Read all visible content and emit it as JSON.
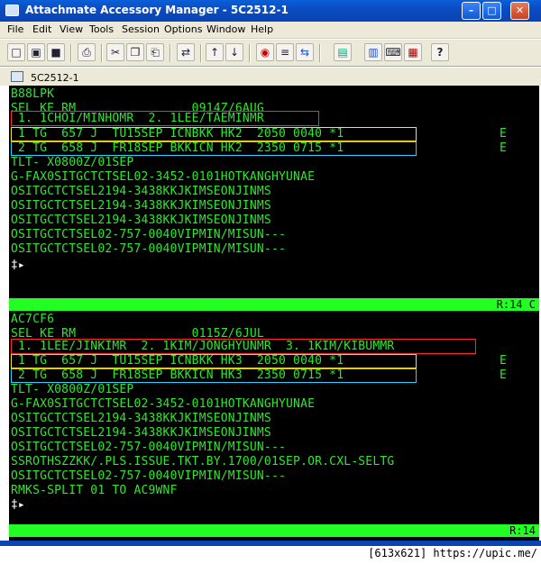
{
  "window": {
    "title": "Attachmate Accessory Manager - 5C2512-1",
    "min_glyph": "–",
    "max_glyph": "□",
    "close_glyph": "✕"
  },
  "menu": [
    "File",
    "Edit",
    "View",
    "Tools",
    "Session",
    "Options",
    "Window",
    "Help"
  ],
  "toolbar": {
    "buttons": [
      {
        "icon": "new-document-icon",
        "glyph": "□"
      },
      {
        "icon": "open-folder-icon",
        "glyph": "▣"
      },
      {
        "icon": "save-icon",
        "glyph": "■"
      },
      {
        "icon": "print-icon",
        "glyph": "⎙"
      },
      {
        "icon": "cut-icon",
        "glyph": "✂"
      },
      {
        "icon": "copy-icon",
        "glyph": "❐"
      },
      {
        "icon": "paste-icon",
        "glyph": "⎗"
      },
      {
        "icon": "connect-icon",
        "glyph": "⇄"
      },
      {
        "icon": "arrow-up-icon",
        "glyph": "↑"
      },
      {
        "icon": "arrow-down-icon",
        "glyph": "↓"
      },
      {
        "icon": "stop-icon",
        "glyph": "◉"
      },
      {
        "icon": "printer-session-icon",
        "glyph": "≡"
      },
      {
        "icon": "transfer-icon",
        "glyph": "⇆"
      },
      {
        "icon": "calculator-icon",
        "glyph": "▤"
      },
      {
        "icon": "notes-icon",
        "glyph": "▥"
      },
      {
        "icon": "keyboard-icon",
        "glyph": "⌨"
      },
      {
        "icon": "screen-icon",
        "glyph": "▦"
      },
      {
        "icon": "help-pointer-icon",
        "glyph": "?"
      }
    ]
  },
  "session": {
    "tab_label": "5C2512-1"
  },
  "terminal": {
    "block1": {
      "lines": [
        "B88LPK",
        "SEL KE RM                0914Z/6AUG",
        " 1. 1CHOI/MINHOMR  2. 1LEE/TAEMINMR",
        " 1 TG  657 J  TU15SEP ICNBKK HK2  2050 0040 *1",
        " 2 TG  658 J  FR18SEP BKKICN HK2  2350 0715 *1",
        "TLT- X0800Z/01SEP",
        "G-FAX0SITGCTCTSEL02-3452-0101HOTKANGHYUNAE",
        "OSITGCTCTSEL2194-3438KKJKIMSEONJINMS",
        "OSITGCTCTSEL2194-3438KKJKIMSEONJINMS",
        "OSITGCTCTSEL2194-3438KKJKIMSEONJINMS",
        "OSITGCTCTSEL02-757-0040VIPMIN/MISUN---",
        "OSITGCTCTSEL02-757-0040VIPMIN/MISUN---"
      ],
      "e_marks": [
        "E",
        "E"
      ],
      "prompt": "‡▸",
      "status": "R:14 C"
    },
    "block2": {
      "lines": [
        "AC7CF6",
        "SEL KE RM                0115Z/6JUL",
        " 1. 1LEE/JINKIMR  2. 1KIM/JONGHYUNMR  3. 1KIM/KIBUMMR",
        " 1 TG  657 J  TU15SEP ICNBKK HK3  2050 0040 *1",
        " 2 TG  658 J  FR18SEP BKKICN HK3  2350 0715 *1",
        "TLT- X0800Z/01SEP",
        "G-FAX0SITGCTCTSEL02-3452-0101HOTKANGHYUNAE",
        "OSITGCTCTSEL2194-3438KKJKIMSEONJINMS",
        "OSITGCTCTSEL2194-3438KKJKIMSEONJINMS",
        "OSITGCTCTSEL02-757-0040VIPMIN/MISUN---",
        "SSROTHSZZKK/.PLS.ISSUE.TKT.BY.1700/01SEP.OR.CXL-SELTG",
        "OSITGCTCTSEL02-757-0040VIPMIN/MISUN---",
        "RMKS-SPLIT 01 TO AC9WNF"
      ],
      "e_marks": [
        "E",
        "E"
      ],
      "prompt": "‡▸",
      "status": "R:14"
    }
  },
  "caption": "[613x621] https://upic.me/",
  "colors": {
    "terminal_text": "#2fe62f",
    "status_bar": "#22ff22",
    "highlight_red": "#ff2a2a",
    "highlight_yellow": "#ffe22a",
    "highlight_cyan": "#2ad0ff"
  }
}
